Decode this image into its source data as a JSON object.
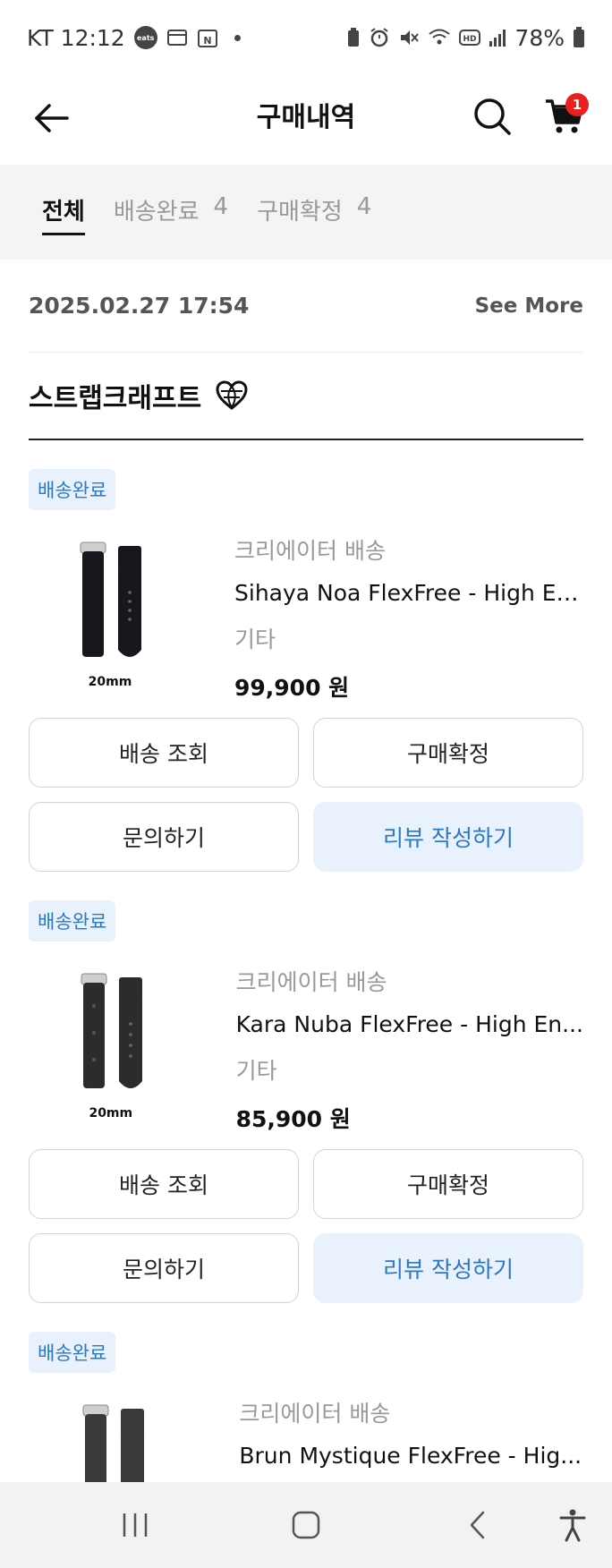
{
  "status_bar": {
    "carrier_time": "KT 12:12",
    "eats_badge": "eats",
    "battery": "78%"
  },
  "header": {
    "title": "구매내역",
    "cart_count": "1"
  },
  "tabs": [
    {
      "label": "전체",
      "count": ""
    },
    {
      "label": "배송완료",
      "count": "4"
    },
    {
      "label": "구매확정",
      "count": "4"
    }
  ],
  "order": {
    "date": "2025.02.27 17:54",
    "see_more": "See More",
    "store_name": "스트랩크래프트"
  },
  "items": [
    {
      "status": "배송완료",
      "shipping_type": "크리에이터 배송",
      "name": "Sihaya Noa FlexFree - High En...",
      "option": "기타",
      "price": "99,900 원",
      "thumb_label": "20mm",
      "buttons": {
        "track": "배송 조회",
        "confirm": "구매확정",
        "inquiry": "문의하기",
        "review": "리뷰 작성하기"
      }
    },
    {
      "status": "배송완료",
      "shipping_type": "크리에이터 배송",
      "name": "Kara Nuba FlexFree - High En...",
      "option": "기타",
      "price": "85,900 원",
      "thumb_label": "20mm",
      "buttons": {
        "track": "배송 조회",
        "confirm": "구매확정",
        "inquiry": "문의하기",
        "review": "리뷰 작성하기"
      }
    },
    {
      "status": "배송완료",
      "shipping_type": "크리에이터 배송",
      "name": "Brun Mystique FlexFree - Hig..."
    }
  ],
  "colors": {
    "accent_blue": "#2b78c5",
    "badge_bg": "#e9f2fc",
    "cart_badge": "#e8201f",
    "tab_bg": "#f4f4f4"
  }
}
